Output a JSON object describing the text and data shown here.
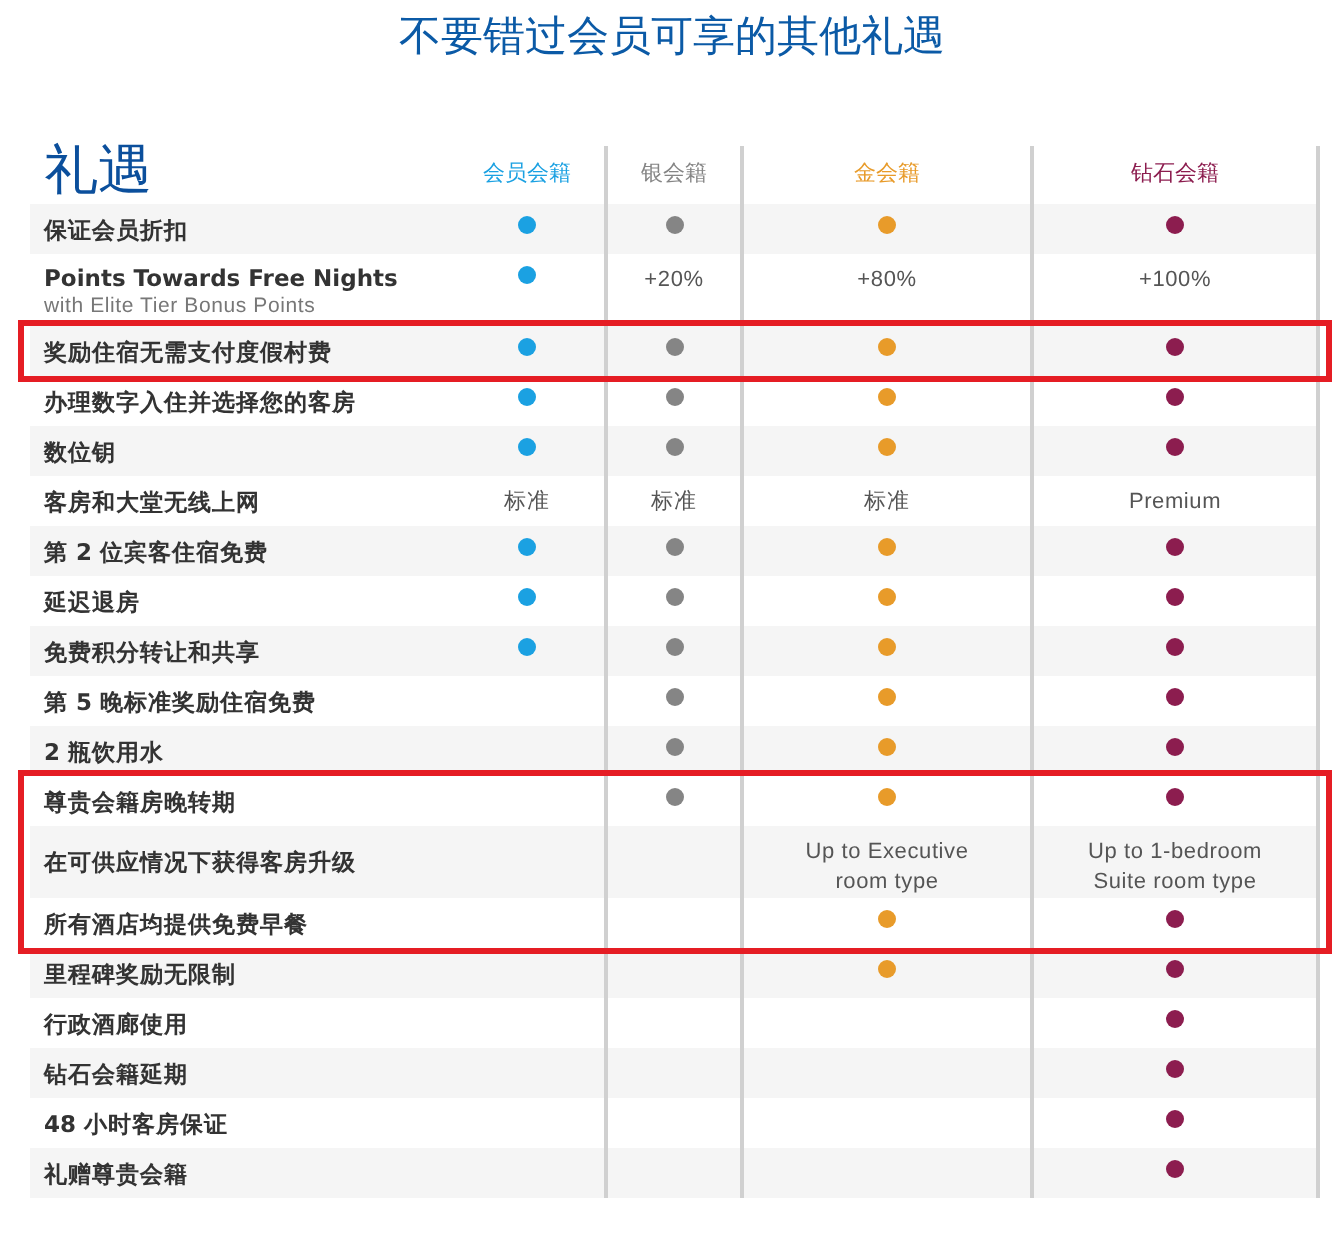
{
  "title": "不要错过会员可享的其他礼遇",
  "table": {
    "heading": "礼遇",
    "tiers": [
      {
        "name": "会员会籍",
        "color": "#1ba1e2"
      },
      {
        "name": "银会籍",
        "color": "#858585"
      },
      {
        "name": "金会籍",
        "color": "#e89b2a"
      },
      {
        "name": "钻石会籍",
        "color": "#8c1d4f"
      }
    ],
    "rows": [
      {
        "label": "保证会员折扣",
        "highlighted": false,
        "cells": [
          {
            "kind": "dot"
          },
          {
            "kind": "dot"
          },
          {
            "kind": "dot"
          },
          {
            "kind": "dot"
          }
        ]
      },
      {
        "label": "Points Towards Free Nights",
        "sublabel": "with Elite Tier Bonus Points",
        "highlighted": false,
        "cells": [
          {
            "kind": "dot"
          },
          {
            "kind": "text",
            "text": "+20%"
          },
          {
            "kind": "text",
            "text": "+80%"
          },
          {
            "kind": "text",
            "text": "+100%"
          }
        ]
      },
      {
        "label": "奖励住宿无需支付度假村费",
        "highlighted": true,
        "cells": [
          {
            "kind": "dot"
          },
          {
            "kind": "dot"
          },
          {
            "kind": "dot"
          },
          {
            "kind": "dot"
          }
        ]
      },
      {
        "label": "办理数字入住并选择您的客房",
        "highlighted": false,
        "cells": [
          {
            "kind": "dot"
          },
          {
            "kind": "dot"
          },
          {
            "kind": "dot"
          },
          {
            "kind": "dot"
          }
        ]
      },
      {
        "label": "数位钥",
        "highlighted": false,
        "cells": [
          {
            "kind": "dot"
          },
          {
            "kind": "dot"
          },
          {
            "kind": "dot"
          },
          {
            "kind": "dot"
          }
        ]
      },
      {
        "label": "客房和大堂无线上网",
        "highlighted": false,
        "cells": [
          {
            "kind": "text",
            "text": "标准"
          },
          {
            "kind": "text",
            "text": "标准"
          },
          {
            "kind": "text",
            "text": "标准"
          },
          {
            "kind": "text",
            "text": "Premium"
          }
        ]
      },
      {
        "label": "第 2 位宾客住宿免费",
        "highlighted": false,
        "cells": [
          {
            "kind": "dot"
          },
          {
            "kind": "dot"
          },
          {
            "kind": "dot"
          },
          {
            "kind": "dot"
          }
        ]
      },
      {
        "label": "延迟退房",
        "highlighted": false,
        "cells": [
          {
            "kind": "dot"
          },
          {
            "kind": "dot"
          },
          {
            "kind": "dot"
          },
          {
            "kind": "dot"
          }
        ]
      },
      {
        "label": "免费积分转让和共享",
        "highlighted": false,
        "cells": [
          {
            "kind": "dot"
          },
          {
            "kind": "dot"
          },
          {
            "kind": "dot"
          },
          {
            "kind": "dot"
          }
        ]
      },
      {
        "label": "第 5 晚标准奖励住宿免费",
        "highlighted": false,
        "cells": [
          {
            "kind": "none"
          },
          {
            "kind": "dot"
          },
          {
            "kind": "dot"
          },
          {
            "kind": "dot"
          }
        ]
      },
      {
        "label": "2 瓶饮用水",
        "highlighted": false,
        "cells": [
          {
            "kind": "none"
          },
          {
            "kind": "dot"
          },
          {
            "kind": "dot"
          },
          {
            "kind": "dot"
          }
        ]
      },
      {
        "label": "尊贵会籍房晚转期",
        "highlighted": true,
        "cells": [
          {
            "kind": "none"
          },
          {
            "kind": "dot"
          },
          {
            "kind": "dot"
          },
          {
            "kind": "dot"
          }
        ]
      },
      {
        "label": "在可供应情况下获得客房升级",
        "highlighted": true,
        "cells": [
          {
            "kind": "none"
          },
          {
            "kind": "none"
          },
          {
            "kind": "text",
            "text": "Up to Executive room type"
          },
          {
            "kind": "text",
            "text": "Up to 1-bedroom Suite room type"
          }
        ]
      },
      {
        "label": "所有酒店均提供免费早餐",
        "highlighted": true,
        "cells": [
          {
            "kind": "none"
          },
          {
            "kind": "none"
          },
          {
            "kind": "dot"
          },
          {
            "kind": "dot"
          }
        ]
      },
      {
        "label": "里程碑奖励无限制",
        "highlighted": false,
        "cells": [
          {
            "kind": "none"
          },
          {
            "kind": "none"
          },
          {
            "kind": "dot"
          },
          {
            "kind": "dot"
          }
        ]
      },
      {
        "label": "行政酒廊使用",
        "highlighted": false,
        "cells": [
          {
            "kind": "none"
          },
          {
            "kind": "none"
          },
          {
            "kind": "none"
          },
          {
            "kind": "dot"
          }
        ]
      },
      {
        "label": "钻石会籍延期",
        "highlighted": false,
        "cells": [
          {
            "kind": "none"
          },
          {
            "kind": "none"
          },
          {
            "kind": "none"
          },
          {
            "kind": "dot"
          }
        ]
      },
      {
        "label": "48 小时客房保证",
        "highlighted": false,
        "cells": [
          {
            "kind": "none"
          },
          {
            "kind": "none"
          },
          {
            "kind": "none"
          },
          {
            "kind": "dot"
          }
        ]
      },
      {
        "label": "礼赠尊贵会籍",
        "highlighted": false,
        "cells": [
          {
            "kind": "none"
          },
          {
            "kind": "none"
          },
          {
            "kind": "none"
          },
          {
            "kind": "dot"
          }
        ]
      }
    ]
  }
}
